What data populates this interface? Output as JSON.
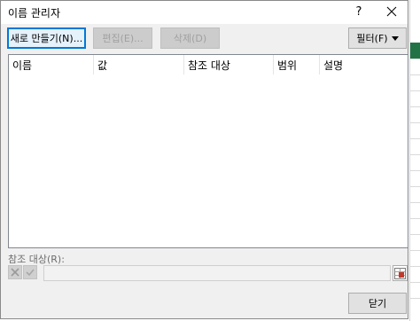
{
  "dialog": {
    "title": "이름 관리자",
    "help_label": "?"
  },
  "toolbar": {
    "new_label": "새로 만들기(N)...",
    "edit_label": "편집(E)...",
    "delete_label": "삭제(D)",
    "filter_label": "필터(F)"
  },
  "list": {
    "columns": [
      "이름",
      "값",
      "참조 대상",
      "범위",
      "설명"
    ],
    "rows": []
  },
  "refers_to": {
    "label": "참조 대상(R):",
    "value": ""
  },
  "footer": {
    "close_label": "닫기"
  },
  "colors": {
    "accent": "#0078d7",
    "sheet_selection": "#217346",
    "cancel_icon": "#9a9a9a",
    "range_icon": "#c0392b"
  },
  "icons": [
    "close-icon",
    "dropdown-arrow-icon",
    "cancel-x-icon",
    "confirm-check-icon",
    "range-select-icon"
  ]
}
